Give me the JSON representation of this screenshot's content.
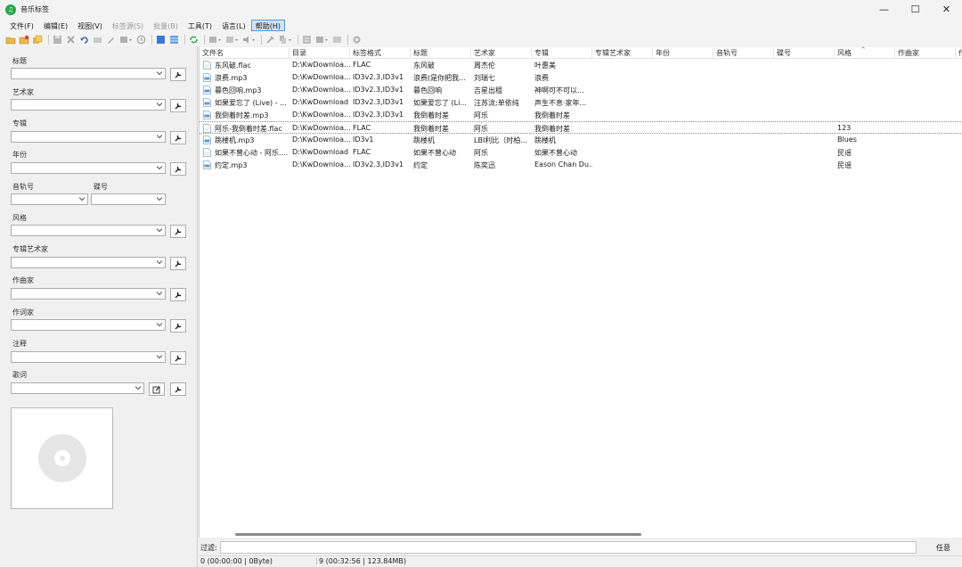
{
  "window": {
    "title": "音乐标签",
    "app_icon_glyph": "♫",
    "controls": [
      "—",
      "☐",
      "✕"
    ]
  },
  "menu": [
    {
      "label": "文件(F)",
      "state": "normal"
    },
    {
      "label": "编辑(E)",
      "state": "normal"
    },
    {
      "label": "视图(V)",
      "state": "normal"
    },
    {
      "label": "标签源(S)",
      "state": "disabled"
    },
    {
      "label": "批量(B)",
      "state": "disabled"
    },
    {
      "label": "工具(T)",
      "state": "normal"
    },
    {
      "label": "语言(L)",
      "state": "normal"
    },
    {
      "label": "帮助(H)",
      "state": "active"
    }
  ],
  "toolbar": {
    "icons": [
      "open-folder-icon",
      "add-folder-icon",
      "add-files-icon",
      "save-icon",
      "delete-icon",
      "undo-icon",
      "rename-icon",
      "edit-icon",
      "batch-edit-icon",
      "clock-icon",
      "view-list-icon",
      "view-detail-icon",
      "refresh-icon",
      "tag-source-icon",
      "artwork-icon",
      "audio-icon",
      "tools-icon",
      "convert-icon",
      "format-icon",
      "playlist-icon",
      "image-icon",
      "settings-icon"
    ]
  },
  "left_panel": {
    "fields": [
      {
        "label": "标题",
        "value": ""
      },
      {
        "label": "艺术家",
        "value": ""
      },
      {
        "label": "专辑",
        "value": ""
      },
      {
        "label": "年份",
        "value": ""
      }
    ],
    "track_label": "音轨号",
    "disc_label": "碟号",
    "fields2": [
      {
        "label": "风格",
        "value": ""
      },
      {
        "label": "专辑艺术家",
        "value": ""
      },
      {
        "label": "作曲家",
        "value": ""
      },
      {
        "label": "作词家",
        "value": ""
      },
      {
        "label": "注释",
        "value": ""
      }
    ],
    "lyrics_label": "歌词"
  },
  "table": {
    "columns": [
      "文件名",
      "目录",
      "标签格式",
      "标题",
      "艺术家",
      "专辑",
      "专辑艺术家",
      "年份",
      "音轨号",
      "碟号",
      "风格",
      "作曲家",
      "作"
    ],
    "rows": [
      {
        "icon": "flac",
        "filename": "东风破.flac",
        "dir": "D:\\KwDownloa...",
        "tagfmt": "FLAC",
        "title": "东风破",
        "artist": "周杰伦",
        "album": "叶惠美",
        "genre": ""
      },
      {
        "icon": "mp3",
        "filename": "浪费.mp3",
        "dir": "D:\\KwDownloa...",
        "tagfmt": "ID3v2.3,ID3v1",
        "title": "浪费(是你把我...",
        "artist": "刘瑞七",
        "album": "浪费",
        "genre": ""
      },
      {
        "icon": "mp3",
        "filename": "暮色回响.mp3",
        "dir": "D:\\KwDownloa...",
        "tagfmt": "ID3v2.3,ID3v1",
        "title": "暮色回响",
        "artist": "吉星出租",
        "album": "神啊可不可以...",
        "genre": ""
      },
      {
        "icon": "mp3",
        "filename": "如果爱忘了 (Live) - ...",
        "dir": "D:\\KwDownload",
        "tagfmt": "ID3v2.3,ID3v1",
        "title": "如果爱忘了 (Li...",
        "artist": "汪苏泷;单依纯",
        "album": "声生不息·家年...",
        "genre": ""
      },
      {
        "icon": "mp3",
        "filename": "我倒着时差.mp3",
        "dir": "D:\\KwDownloa...",
        "tagfmt": "ID3v2.3,ID3v1",
        "title": "我倒着时差",
        "artist": "阿乐",
        "album": "我倒着时差",
        "genre": ""
      },
      {
        "icon": "flac",
        "filename": "阿乐-我倒着时差.flac",
        "dir": "D:\\KwDownloa...",
        "tagfmt": "FLAC",
        "title": "我倒着时差",
        "artist": "阿乐",
        "album": "我倒着时差",
        "genre": "123",
        "selected": true
      },
      {
        "icon": "mp3",
        "filename": "跳楼机.mp3",
        "dir": "D:\\KwDownloa...",
        "tagfmt": "ID3v1",
        "title": "跳楼机",
        "artist": "LBI利比（时柏...",
        "album": "跳楼机",
        "genre": "Blues"
      },
      {
        "icon": "flac",
        "filename": "如果不曾心动 - 阿乐....",
        "dir": "D:\\KwDownload",
        "tagfmt": "FLAC",
        "title": "如果不曾心动",
        "artist": "阿乐",
        "album": "如果不曾心动",
        "genre": "民谣"
      },
      {
        "icon": "mp3",
        "filename": "约定.mp3",
        "dir": "D:\\KwDownloa...",
        "tagfmt": "ID3v2.3,ID3v1",
        "title": "约定",
        "artist": "陈奕迅",
        "album": "Eason Chan Du...",
        "genre": "民谣"
      }
    ]
  },
  "filter": {
    "label": "过滤:",
    "value": "",
    "mode": "任意"
  },
  "status": {
    "selection": "0 (00:00:00 | 0Byte)",
    "total": "9 (00:32:56 | 123.84MB)"
  },
  "colors": {
    "menu_active_bg": "#cce4f7",
    "menu_active_border": "#5b9bd5",
    "mp3_icon": "#5b9bd5",
    "app_icon": "#2aa84a"
  }
}
